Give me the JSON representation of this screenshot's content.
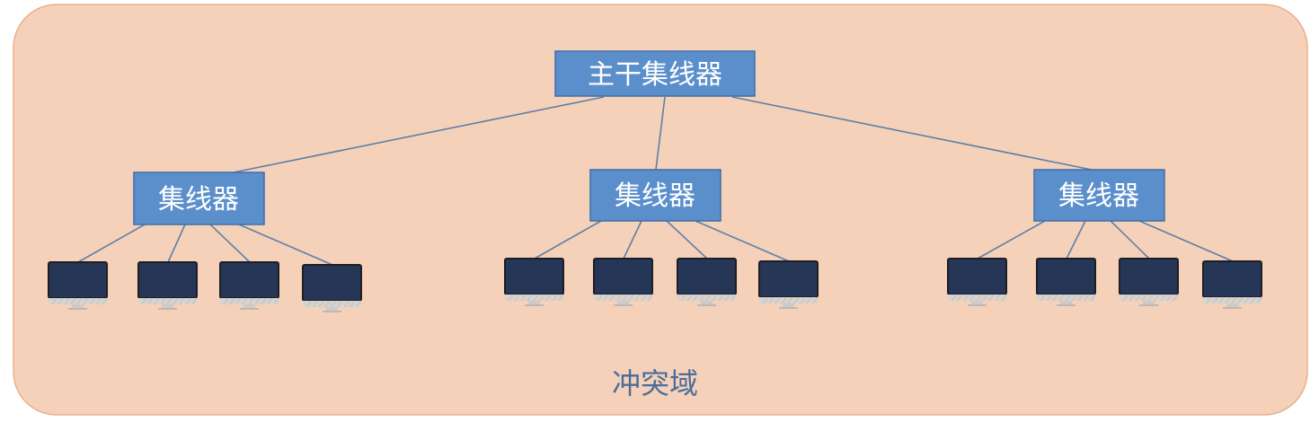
{
  "diagram": {
    "backbone_hub": {
      "label": "主干集线器"
    },
    "hubs": [
      {
        "label": "集线器",
        "computers": 4
      },
      {
        "label": "集线器",
        "computers": 4
      },
      {
        "label": "集线器",
        "computers": 4
      }
    ],
    "domain_label": "冲突域",
    "colors": {
      "region_fill": "#f5d1b9",
      "region_border": "#eab08f",
      "box_fill": "#5b8fcb",
      "box_border": "#3f6ea8",
      "line": "#5d7fa8",
      "monitor": "#263656",
      "label": "#4b6d9c"
    }
  }
}
